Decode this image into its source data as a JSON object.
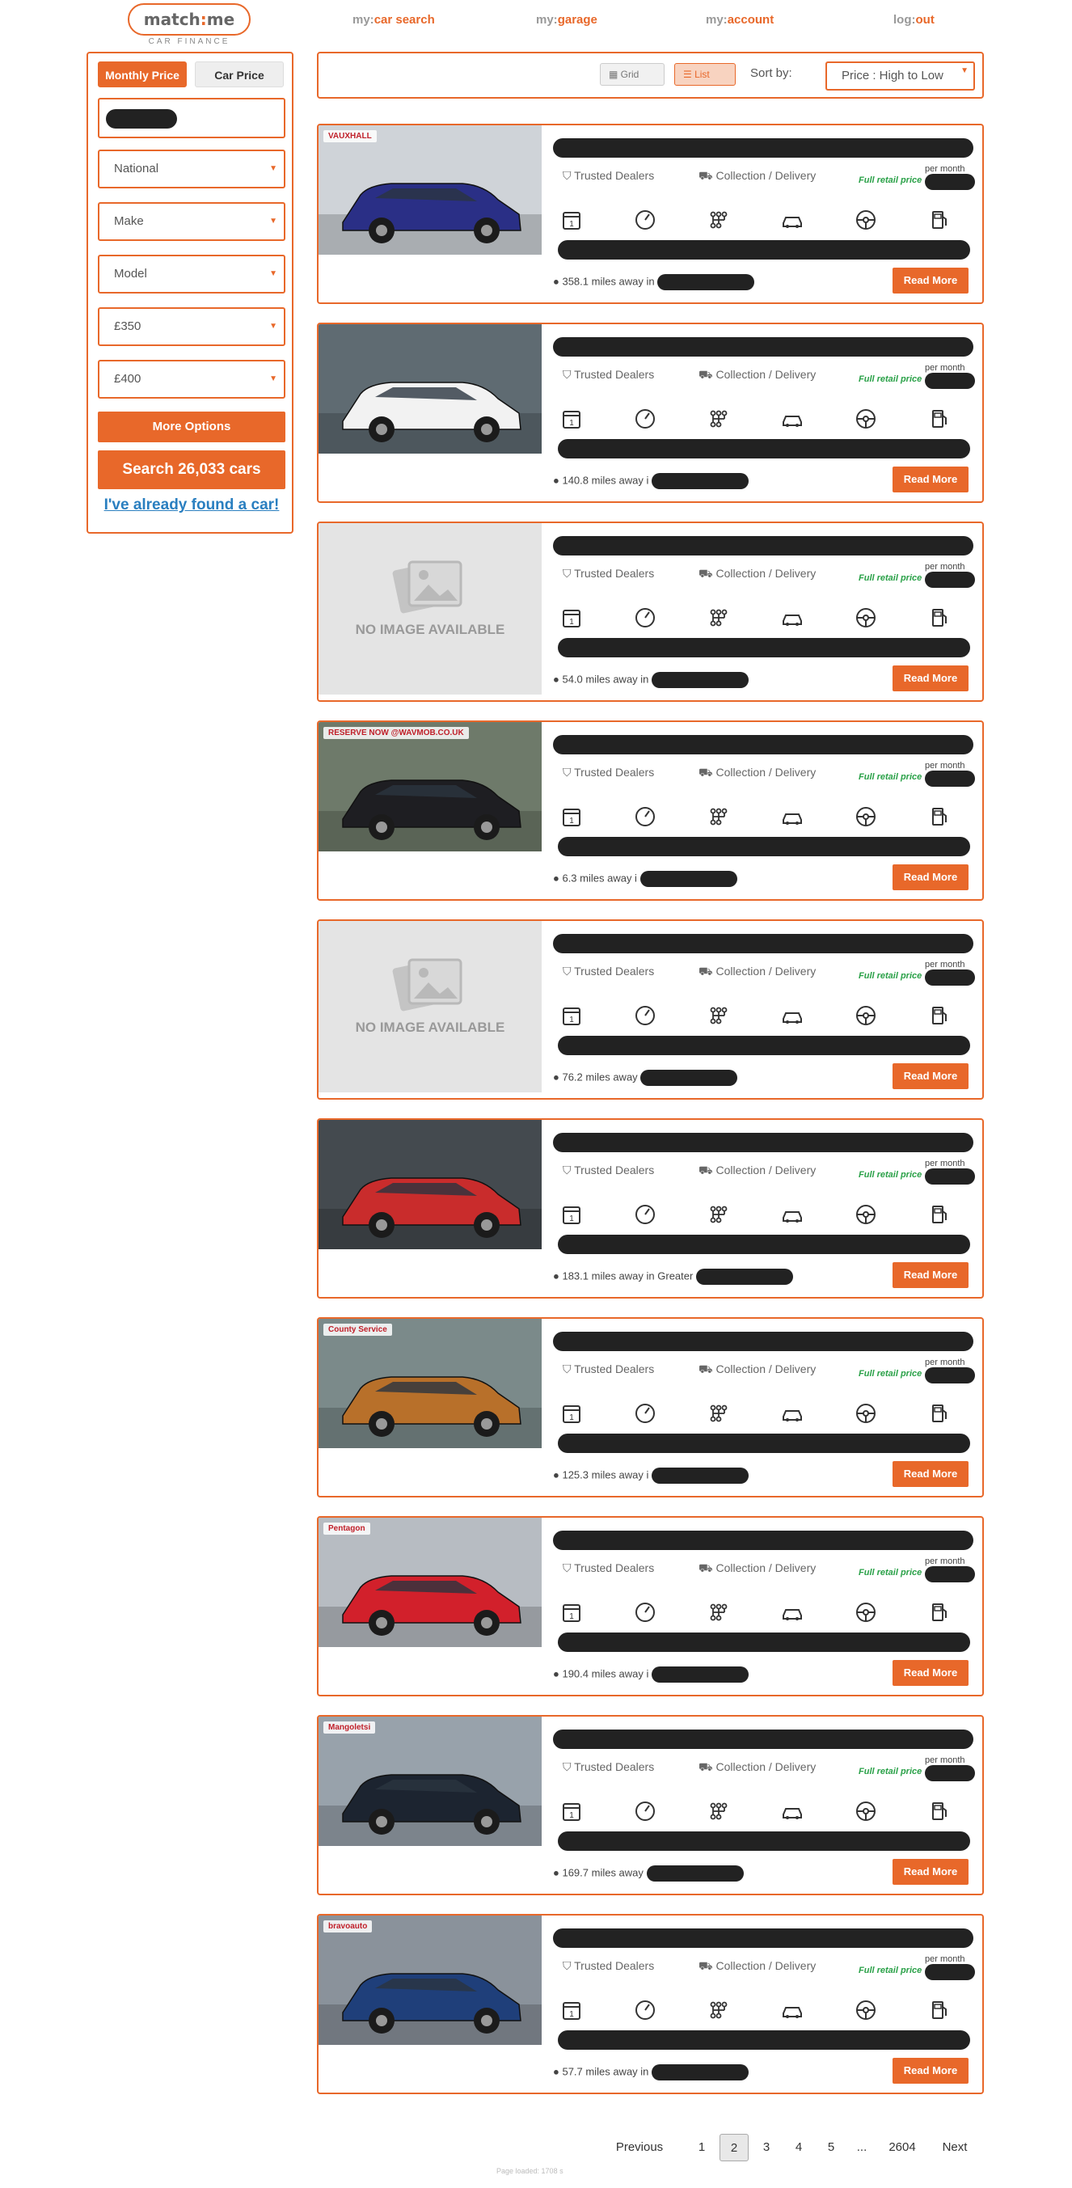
{
  "brand": {
    "name_left": "match",
    "name_sep": ":",
    "name_right": "me",
    "subtitle": "CAR FINANCE"
  },
  "nav": [
    {
      "prefix": "my:",
      "label": "car search"
    },
    {
      "prefix": "my:",
      "label": "garage"
    },
    {
      "prefix": "my:",
      "label": "account"
    },
    {
      "prefix": "log:",
      "label": "out"
    }
  ],
  "sidebar": {
    "tab_monthly": "Monthly Price",
    "tab_car": "Car Price",
    "location": "National",
    "make": "Make",
    "model": "Model",
    "price_min": "£350",
    "price_max": "£400",
    "more_options": "More Options",
    "search_button": "Search 26,033 cars",
    "found_link": "I've already found a car!"
  },
  "toolbar": {
    "grid": "Grid",
    "list": "List",
    "sort_label": "Sort by:",
    "sort_value": "Price : High to Low"
  },
  "card_common": {
    "trusted": "Trusted Dealers",
    "delivery": "Collection / Delivery",
    "retail": "Full retail price",
    "per_month": "per month",
    "read_more": "Read More",
    "no_image": "NO IMAGE AVAILABLE"
  },
  "listings": [
    {
      "distance": "358.1 miles away in",
      "image": "photo",
      "dealer_badge": "VAUXHALL",
      "car_color": "#2a2f86",
      "bg": "#cfd3d8"
    },
    {
      "distance": "140.8 miles away i",
      "image": "photo",
      "dealer_badge": "",
      "car_color": "#f2f2f2",
      "bg": "#5f6b72"
    },
    {
      "distance": "54.0 miles away in",
      "image": "none",
      "dealer_badge": "",
      "car_color": "",
      "bg": ""
    },
    {
      "distance": "6.3 miles away i",
      "image": "photo",
      "dealer_badge": "RESERVE NOW @WAVMOB.CO.UK",
      "car_color": "#1e1e22",
      "bg": "#6e7a6a"
    },
    {
      "distance": "76.2 miles away",
      "image": "none",
      "dealer_badge": "",
      "car_color": "",
      "bg": ""
    },
    {
      "distance": "183.1 miles away in Greater",
      "image": "photo",
      "dealer_badge": "",
      "car_color": "#c92c2c",
      "bg": "#444a4f"
    },
    {
      "distance": "125.3 miles away i",
      "image": "photo",
      "dealer_badge": "County Service",
      "car_color": "#b8702a",
      "bg": "#7b8a8a"
    },
    {
      "distance": "190.4 miles away i",
      "image": "photo",
      "dealer_badge": "Pentagon",
      "car_color": "#d2202b",
      "bg": "#b7bcc2"
    },
    {
      "distance": "169.7 miles away",
      "image": "photo",
      "dealer_badge": "Mangoletsi",
      "car_color": "#1c2430",
      "bg": "#98a2ab"
    },
    {
      "distance": "57.7 miles away in",
      "image": "photo",
      "dealer_badge": "bravoauto",
      "car_color": "#1f3f7a",
      "bg": "#8a929b"
    }
  ],
  "pagination": {
    "prev": "Previous",
    "pages": [
      "1",
      "2",
      "3",
      "4",
      "5",
      "...",
      "2604"
    ],
    "current": "2",
    "next": "Next"
  },
  "footer": {
    "page_loaded": "Page loaded: 1708 s"
  }
}
